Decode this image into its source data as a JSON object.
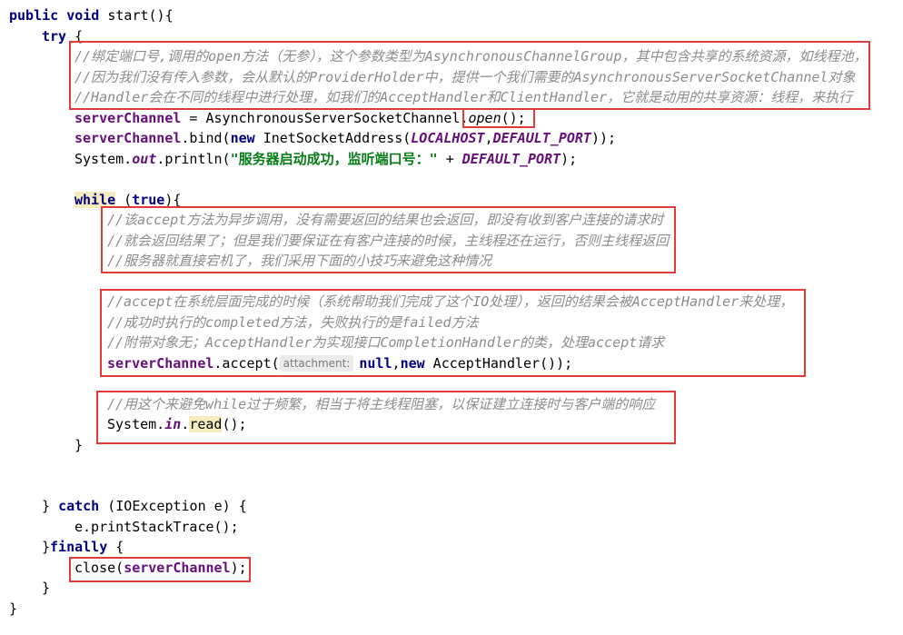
{
  "code": {
    "l1": {
      "kw1": "public",
      "kw2": "void",
      "rest": " start(){"
    },
    "l2": {
      "kw": "try",
      "rest": " {"
    },
    "c1": "//绑定端口号,调用的open方法（无参），这个参数类型为AsynchronousChannelGroup，其中包含共享的系统资源，如线程池，",
    "c2": "//因为我们没有传入参数，会从默认的ProviderHolder中，提供一个我们需要的AsynchronousServerSocketChannel对象",
    "c3": "//Handler会在不同的线程中进行处理，如我们的AcceptHandler和ClientHandler，它就是动用的共享资源：线程，来执行",
    "l6": {
      "fld": "serverChannel",
      "mid": " = AsynchronousServerSocketChannel.",
      "m": "open",
      "end": "();"
    },
    "l7": {
      "fld": "serverChannel",
      "mid": ".bind(",
      "kw": "new",
      "mid2": " InetSocketAddress(",
      "c1": "LOCALHOST",
      "comma": ",",
      "c2": "DEFAULT_PORT",
      "end": "));"
    },
    "l8": {
      "a": "System.",
      "out": "out",
      "b": ".println(",
      "str": "\"服务器启动成功，监听端口号：\"",
      "c": " + ",
      "port": "DEFAULT_PORT",
      "end": ");"
    },
    "l10": {
      "kw": "while",
      "a": " (",
      "t": "true",
      "b": "){"
    },
    "c4": "//该accept方法为异步调用，没有需要返回的结果也会返回，即没有收到客户连接的请求时",
    "c5": "//就会返回结果了；但是我们要保证在有客户连接的时候，主线程还在运行，否则主线程返回",
    "c6": "//服务器就直接宕机了，我们采用下面的小技巧来避免这种情况",
    "c7": "//accept在系统层面完成的时候（系统帮助我们完成了这个IO处理），返回的结果会被AcceptHandler来处理，",
    "c8": "//成功时执行的completed方法，失败执行的是failed方法",
    "c9": "//附带对象无；AcceptHandler为实现接口CompletionHandler的类，处理accept请求",
    "l18": {
      "fld": "serverChannel",
      "a": ".accept(",
      "hint": "attachment:",
      "nul": "null",
      "comma": ",",
      "kw": "new",
      "b": " AcceptHandler());"
    },
    "c10": "//用这个来避免while过于频繁，相当于将主线程阻塞，以保证建立连接时与客户端的响应",
    "l21": {
      "a": "System.",
      "in": "in",
      "b": ".",
      "read": "read",
      "c": "();"
    },
    "l22": "}",
    "l25": {
      "a": "} ",
      "kw": "catch",
      "b": " (IOException e) {"
    },
    "l26": "e.printStackTrace();",
    "l27": {
      "a": "}",
      "kw": "finally",
      "b": " {"
    },
    "l28": {
      "a": "close(",
      "fld": "serverChannel",
      "b": ");"
    },
    "l29": "}",
    "l30": "}"
  },
  "colors": {
    "keyword": "#000080",
    "field": "#660e7a",
    "string": "#067d17",
    "comment": "#8c8c8c",
    "highlight_box": "#e03a3a"
  }
}
